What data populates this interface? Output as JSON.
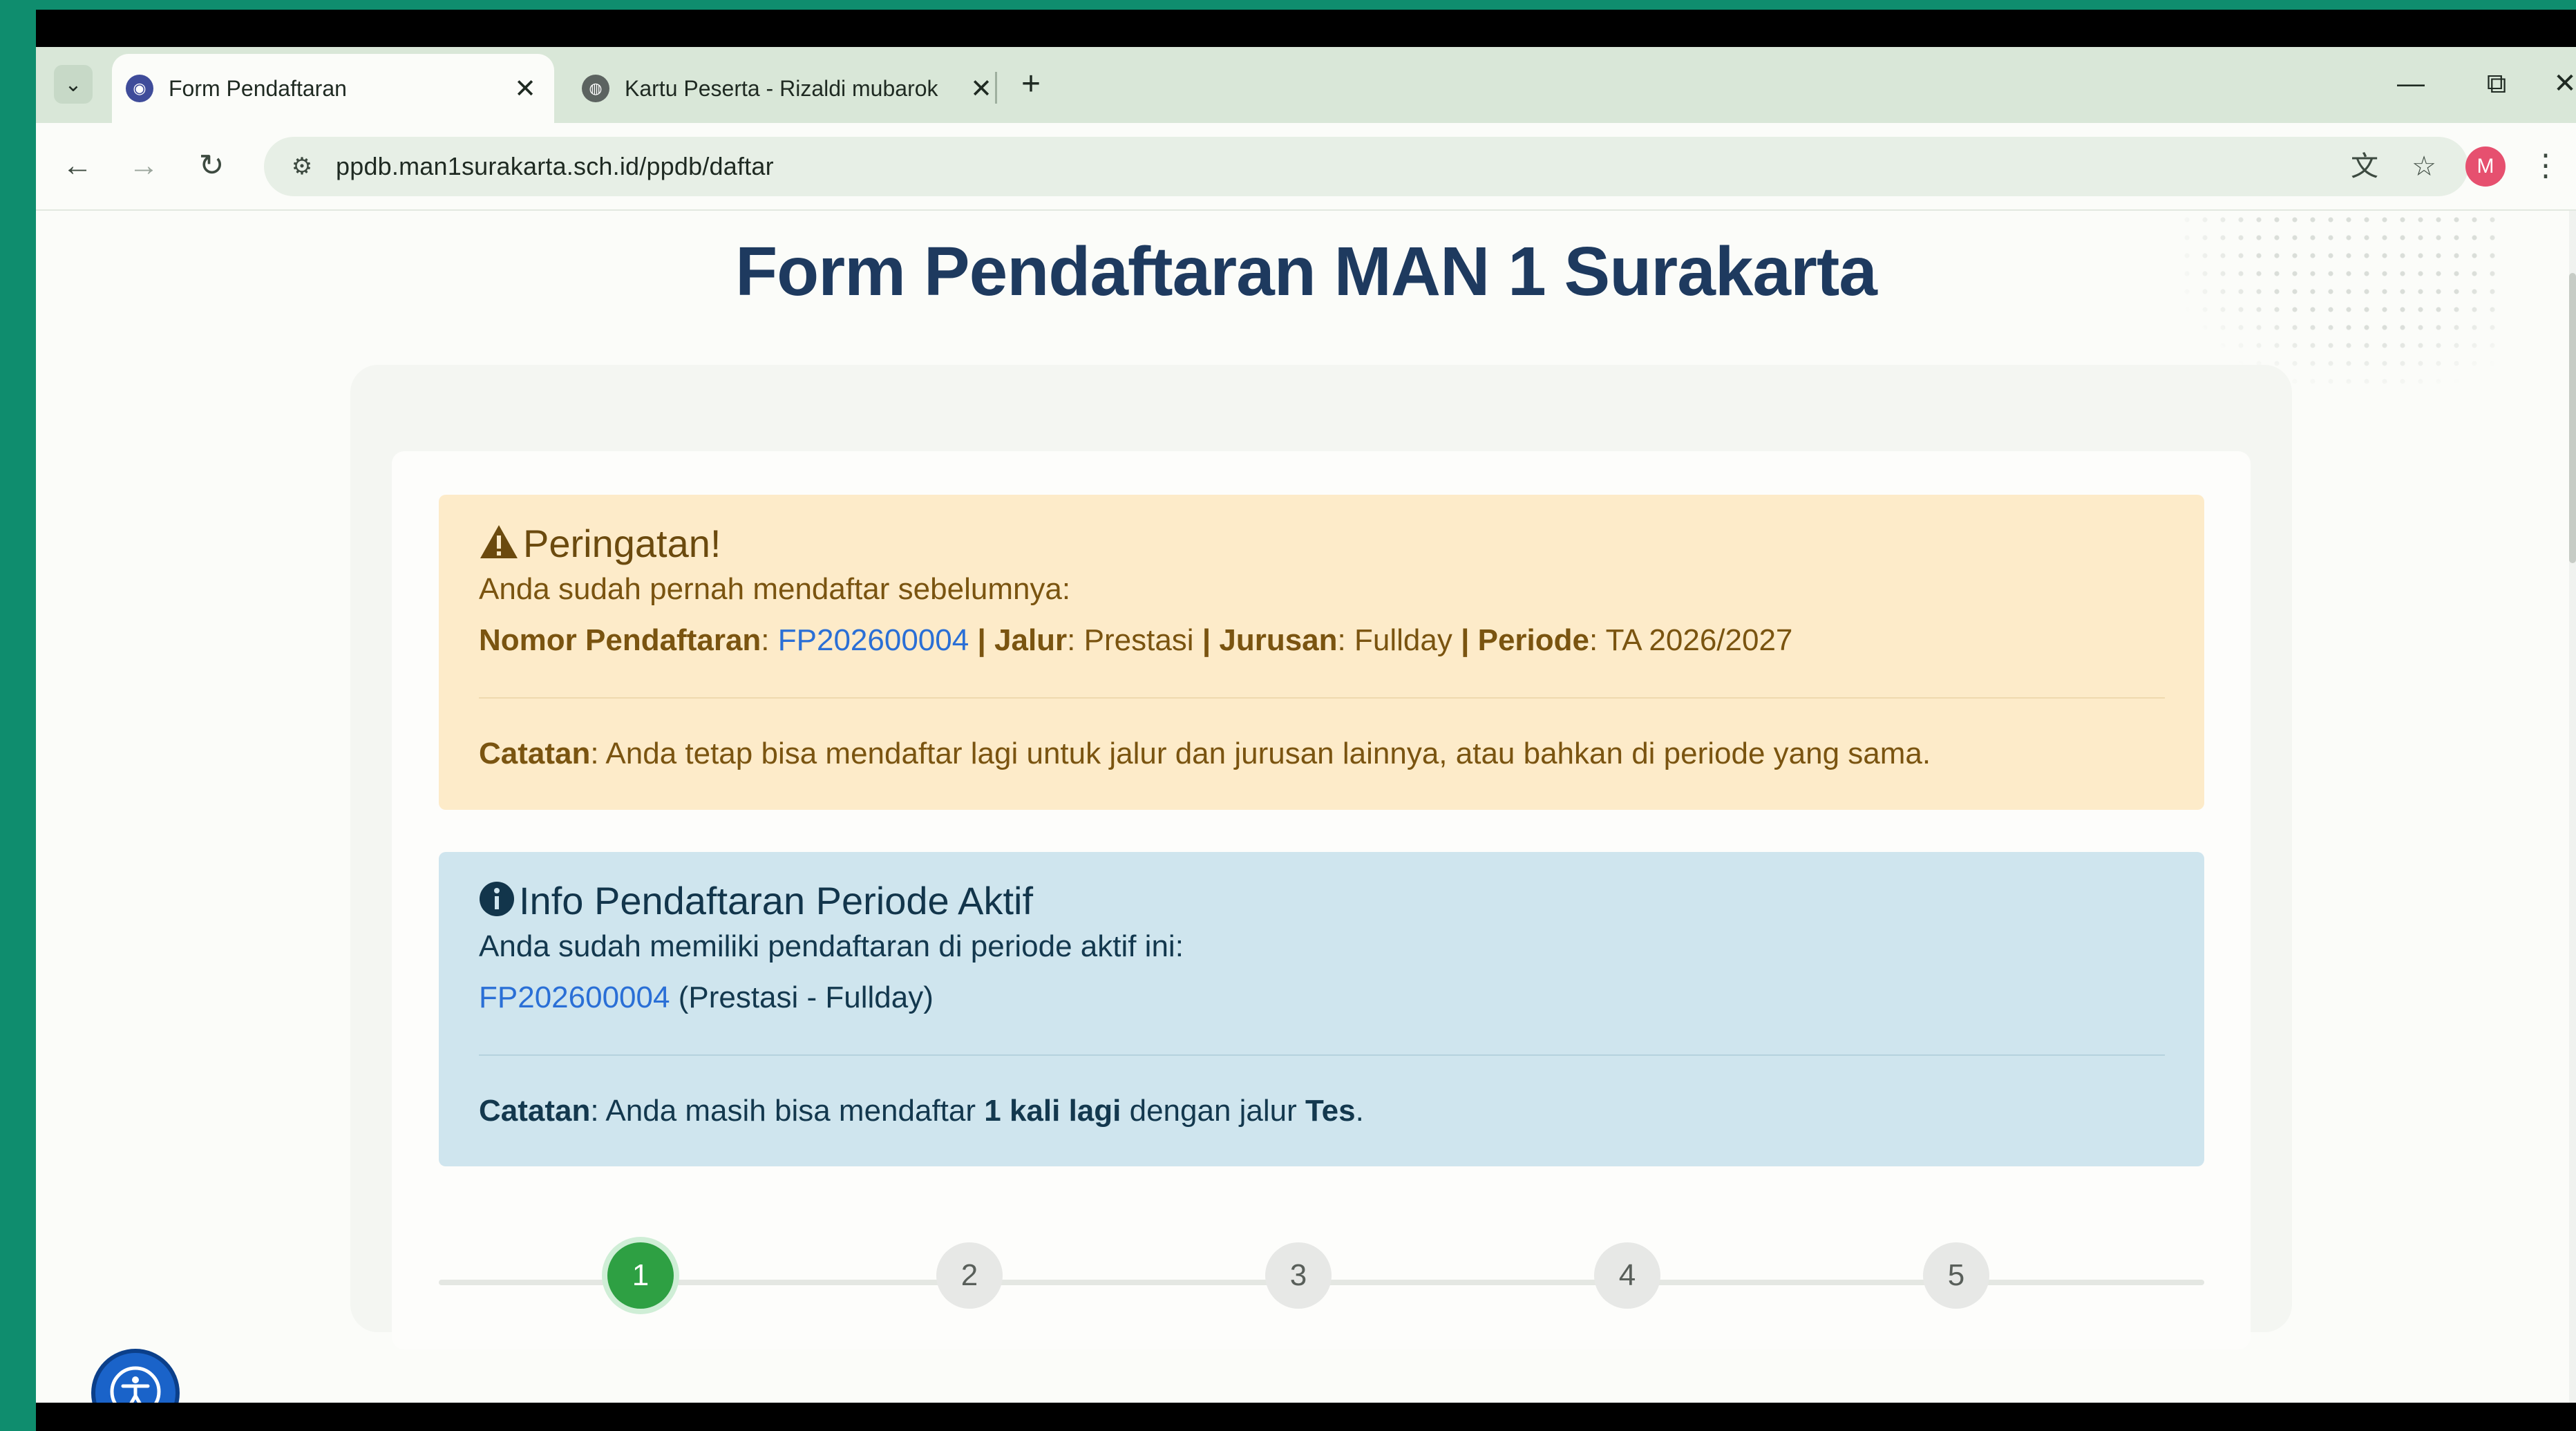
{
  "browser": {
    "tabs": [
      {
        "title": "Form Pendaftaran",
        "active": true
      },
      {
        "title": "Kartu Peserta - Rizaldi mubarok",
        "active": false
      }
    ],
    "new_tab_label": "+",
    "url": "ppdb.man1surakarta.sch.id/ppdb/daftar",
    "profile_initial": "M"
  },
  "page": {
    "title": "Form Pendaftaran MAN 1 Surakarta",
    "warning": {
      "heading": "Peringatan!",
      "intro": "Anda sudah pernah mendaftar sebelumnya:",
      "nomor_label": "Nomor Pendaftaran",
      "nomor_value": "FP202600004",
      "jalur_label": "Jalur",
      "jalur_value": "Prestasi",
      "jurusan_label": "Jurusan",
      "jurusan_value": "Fullday",
      "periode_label": "Periode",
      "periode_value": "TA 2026/2027",
      "note_label": "Catatan",
      "note_text": "Anda tetap bisa mendaftar lagi untuk jalur dan jurusan lainnya, atau bahkan di periode yang sama."
    },
    "info": {
      "heading": "Info Pendaftaran Periode Aktif",
      "intro": "Anda sudah memiliki pendaftaran di periode aktif ini:",
      "reg_link": "FP202600004",
      "reg_detail": "(Prestasi - Fullday)",
      "note_label": "Catatan",
      "note_pre": "Anda masih bisa mendaftar ",
      "note_bold1": "1 kali lagi",
      "note_mid": " dengan jalur ",
      "note_bold2": "Tes",
      "note_end": "."
    },
    "steps": [
      "1",
      "2",
      "3",
      "4",
      "5"
    ],
    "current_step": 1
  },
  "colors": {
    "title": "#1e3a5f",
    "warning_bg": "#fdebc9",
    "info_bg": "#cfe5ee",
    "link": "#2a6fd6",
    "step_active": "#2ea043"
  }
}
